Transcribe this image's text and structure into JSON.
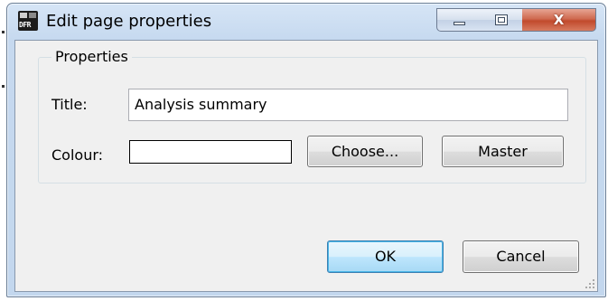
{
  "window": {
    "title": "Edit page properties",
    "close_glyph": "X",
    "app_icon_text": "DFR"
  },
  "properties_group": {
    "title": "Properties",
    "title_label": "Title:",
    "title_value": "Analysis summary",
    "colour_label": "Colour:",
    "colour_value": "",
    "choose_label": "Choose...",
    "master_label": "Master"
  },
  "footer": {
    "ok_label": "OK",
    "cancel_label": "Cancel"
  },
  "icons": [
    "app-icon",
    "minimize-icon",
    "maximize-icon",
    "close-icon",
    "resize-grip-icon"
  ]
}
